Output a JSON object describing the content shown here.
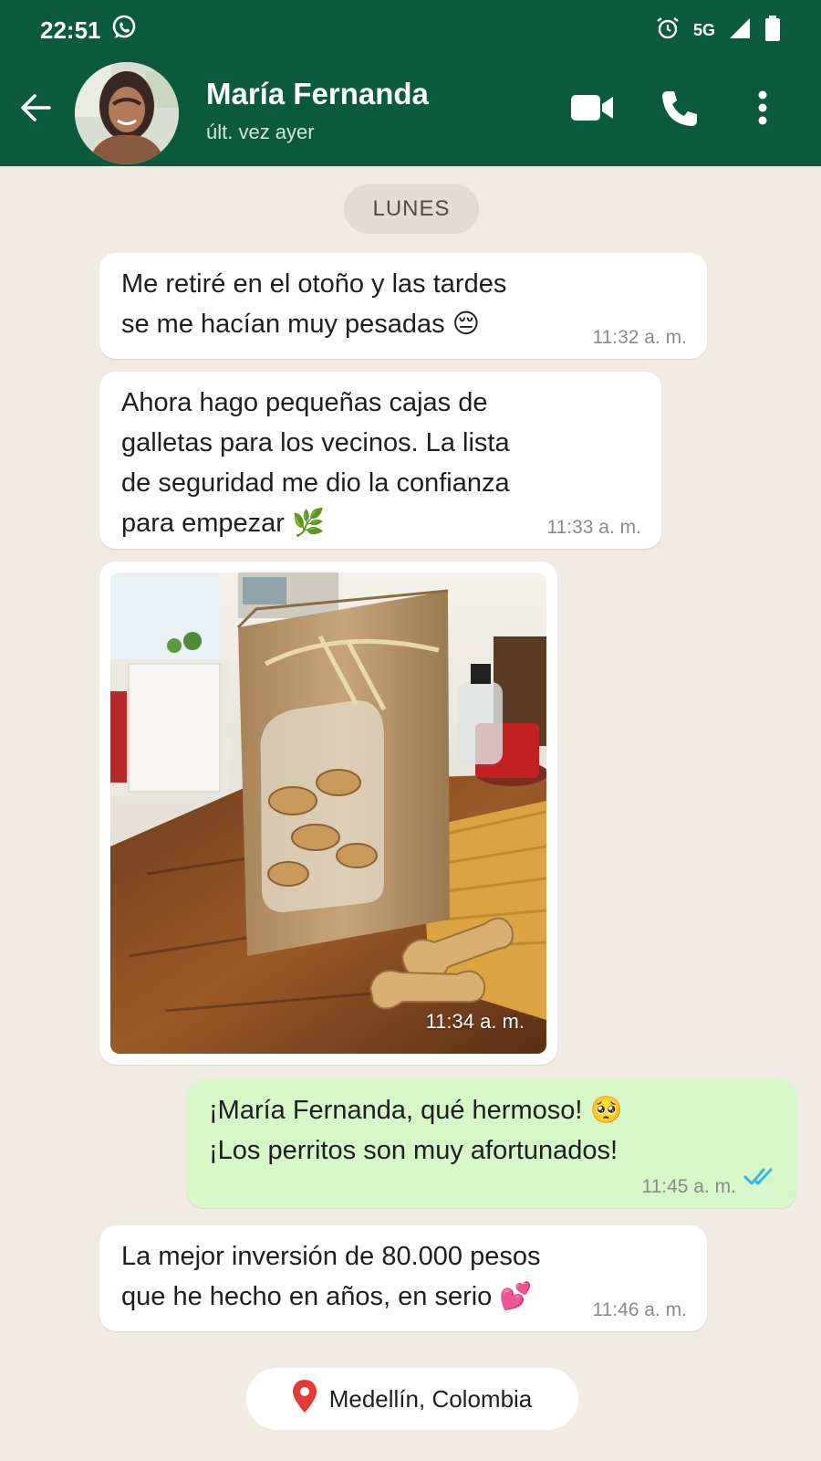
{
  "status_bar": {
    "time": "22:51",
    "network": "5G",
    "icons": [
      "whatsapp-icon",
      "alarm-icon",
      "signal-icon",
      "battery-icon"
    ]
  },
  "header": {
    "contact_name": "María Fernanda",
    "last_seen": "últ. vez ayer",
    "icons": [
      "back-arrow-icon",
      "video-call-icon",
      "phone-call-icon",
      "more-options-icon"
    ]
  },
  "chat": {
    "day_label": "LUNES",
    "messages": [
      {
        "direction": "in",
        "text": "Me retiré en el otoño y las tardes\nse me hacían muy pesadas 😔",
        "time": "11:32 a. m."
      },
      {
        "direction": "in",
        "text": "Ahora hago pequeñas cajas de\ngalletas para los vecinos. La lista\nde seguridad me dio la confianza\npara empezar 🌿",
        "time": "11:33 a. m."
      },
      {
        "direction": "in",
        "type": "image",
        "time": "11:34 a. m."
      },
      {
        "direction": "out",
        "text": "¡María Fernanda, qué hermoso! 🥺\n¡Los perritos son muy afortunados!",
        "time": "11:45 a. m.",
        "status": "read"
      },
      {
        "direction": "in",
        "text": "La mejor inversión de 80.000 pesos\nque he hecho en años, en serio 💕",
        "time": "11:46 a. m."
      }
    ],
    "location": "Medellín, Colombia"
  },
  "colors": {
    "header": "#0b5a3e",
    "chat_bg": "#efeae2",
    "outgoing_bubble": "#d6f7c8",
    "read_ticks": "#34b7f1",
    "location_pin": "#e53935"
  }
}
